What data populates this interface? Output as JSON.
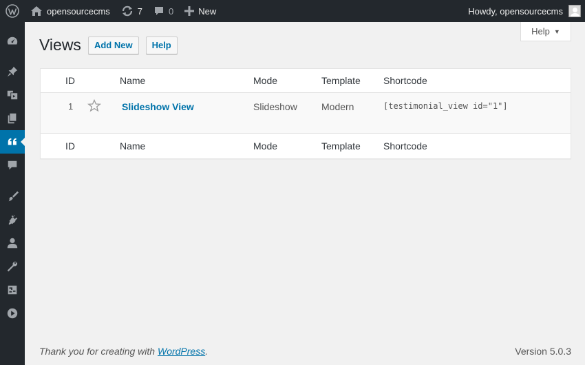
{
  "adminbar": {
    "site_name": "opensourcecms",
    "updates_count": "7",
    "comments_count": "0",
    "new_label": "New",
    "howdy": "Howdy, opensourcecms"
  },
  "help_tab": {
    "label": "Help"
  },
  "page": {
    "title": "Views",
    "add_new_label": "Add New",
    "help_label": "Help"
  },
  "table": {
    "headers": {
      "id": "ID",
      "name": "Name",
      "mode": "Mode",
      "template": "Template",
      "shortcode": "Shortcode"
    },
    "rows": [
      {
        "id": "1",
        "name": "Slideshow View",
        "mode": "Slideshow",
        "template": "Modern",
        "shortcode": "[testimonial_view id=\"1\"]"
      }
    ]
  },
  "footer": {
    "thanks_prefix": "Thank you for creating with ",
    "wordpress_link": "WordPress",
    "thanks_suffix": ".",
    "version": "Version 5.0.3"
  },
  "colors": {
    "adminbar_bg": "#23282d",
    "accent": "#0073aa",
    "page_bg": "#f1f1f1"
  }
}
